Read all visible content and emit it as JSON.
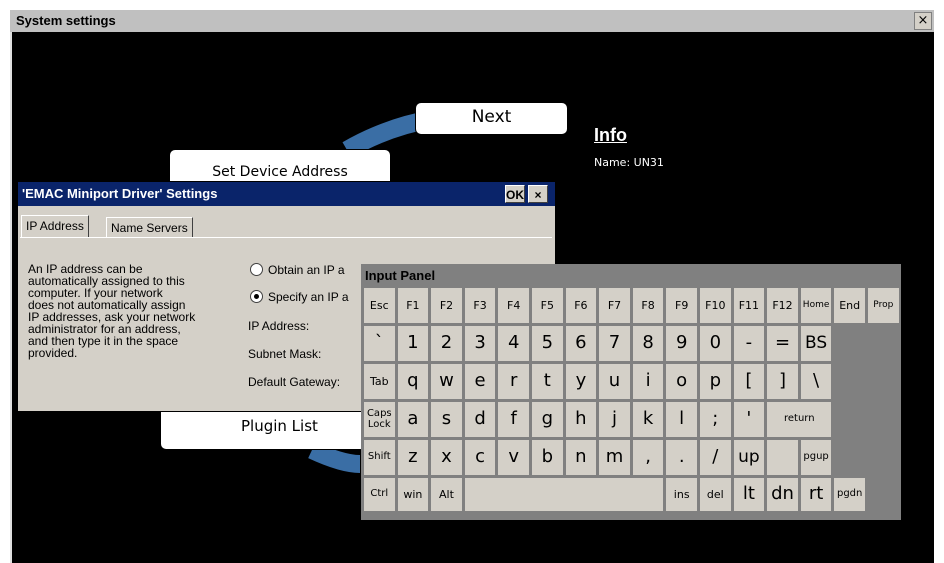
{
  "window": {
    "title": "System settings",
    "close_glyph": "×"
  },
  "wizard": {
    "next_label": "Next",
    "set_device_label": "Set Device Address",
    "plugin_list_label": "Plugin List"
  },
  "info": {
    "title": "Info",
    "name_line": "Name: UN31"
  },
  "dialog": {
    "title": "'EMAC Miniport Driver' Settings",
    "ok_label": "OK",
    "close_glyph": "×",
    "tabs": [
      "IP Address",
      "Name Servers"
    ],
    "description_lines": [
      "An IP address can be",
      "automatically assigned to this",
      "computer.  If your network",
      "does not automatically assign",
      "IP addresses, ask your network",
      "administrator for an address,",
      "and then type it in the space",
      "provided."
    ],
    "radio_obtain": "Obtain an IP a",
    "radio_specify": "Specify an IP a",
    "ip_address_label": "IP Address:",
    "subnet_label": "Subnet Mask:",
    "gateway_label": "Default Gateway:"
  },
  "input_panel": {
    "title": "Input Panel",
    "rows": [
      [
        {
          "l": "Esc",
          "w": 1
        },
        {
          "l": "F1",
          "w": 1
        },
        {
          "l": "F2",
          "w": 1
        },
        {
          "l": "F3",
          "w": 1
        },
        {
          "l": "F4",
          "w": 1
        },
        {
          "l": "F5",
          "w": 1
        },
        {
          "l": "F6",
          "w": 1
        },
        {
          "l": "F7",
          "w": 1
        },
        {
          "l": "F8",
          "w": 1
        },
        {
          "l": "F9",
          "w": 1
        },
        {
          "l": "F10",
          "w": 1
        },
        {
          "l": "F11",
          "w": 1
        },
        {
          "l": "F12",
          "w": 1
        },
        {
          "l": "Home",
          "w": 1
        },
        {
          "l": "End",
          "w": 1
        },
        {
          "l": "Prop",
          "w": 1
        }
      ],
      [
        {
          "l": "`",
          "w": 1
        },
        {
          "l": "1",
          "w": 1
        },
        {
          "l": "2",
          "w": 1
        },
        {
          "l": "3",
          "w": 1
        },
        {
          "l": "4",
          "w": 1
        },
        {
          "l": "5",
          "w": 1
        },
        {
          "l": "6",
          "w": 1
        },
        {
          "l": "7",
          "w": 1
        },
        {
          "l": "8",
          "w": 1
        },
        {
          "l": "9",
          "w": 1
        },
        {
          "l": "0",
          "w": 1
        },
        {
          "l": "-",
          "w": 1
        },
        {
          "l": "=",
          "w": 1
        },
        {
          "l": "BS",
          "w": 1
        }
      ],
      [
        {
          "l": "Tab",
          "w": 1
        },
        {
          "l": "q",
          "w": 1
        },
        {
          "l": "w",
          "w": 1
        },
        {
          "l": "e",
          "w": 1
        },
        {
          "l": "r",
          "w": 1
        },
        {
          "l": "t",
          "w": 1
        },
        {
          "l": "y",
          "w": 1
        },
        {
          "l": "u",
          "w": 1
        },
        {
          "l": "i",
          "w": 1
        },
        {
          "l": "o",
          "w": 1
        },
        {
          "l": "p",
          "w": 1
        },
        {
          "l": "[",
          "w": 1
        },
        {
          "l": "]",
          "w": 1
        },
        {
          "l": "\\",
          "w": 1
        }
      ],
      [
        {
          "l": "Caps\nLock",
          "w": 1
        },
        {
          "l": "a",
          "w": 1
        },
        {
          "l": "s",
          "w": 1
        },
        {
          "l": "d",
          "w": 1
        },
        {
          "l": "f",
          "w": 1
        },
        {
          "l": "g",
          "w": 1
        },
        {
          "l": "h",
          "w": 1
        },
        {
          "l": "j",
          "w": 1
        },
        {
          "l": "k",
          "w": 1
        },
        {
          "l": "l",
          "w": 1
        },
        {
          "l": ";",
          "w": 1
        },
        {
          "l": "'",
          "w": 1
        },
        {
          "l": "return",
          "w": 2
        }
      ],
      [
        {
          "l": "Shift",
          "w": 1
        },
        {
          "l": "z",
          "w": 1
        },
        {
          "l": "x",
          "w": 1
        },
        {
          "l": "c",
          "w": 1
        },
        {
          "l": "v",
          "w": 1
        },
        {
          "l": "b",
          "w": 1
        },
        {
          "l": "n",
          "w": 1
        },
        {
          "l": "m",
          "w": 1
        },
        {
          "l": ",",
          "w": 1
        },
        {
          "l": ".",
          "w": 1
        },
        {
          "l": "/",
          "w": 1
        },
        {
          "l": "up",
          "w": 1
        },
        {
          "l": "",
          "w": 1
        },
        {
          "l": "pgup",
          "w": 1
        }
      ],
      [
        {
          "l": "Ctrl",
          "w": 1
        },
        {
          "l": "win",
          "w": 1
        },
        {
          "l": "Alt",
          "w": 1
        },
        {
          "l": "",
          "w": 6
        },
        {
          "l": "ins",
          "w": 1
        },
        {
          "l": "del",
          "w": 1
        },
        {
          "l": "lt",
          "w": 1
        },
        {
          "l": "dn",
          "w": 1
        },
        {
          "l": "rt",
          "w": 1
        },
        {
          "l": "pgdn",
          "w": 1
        }
      ]
    ]
  },
  "colors": {
    "desktop": "#000000",
    "dialog_caption": "#0a246a",
    "arc_blue": "#3a6ea5",
    "key_face": "#d4d0c8"
  }
}
